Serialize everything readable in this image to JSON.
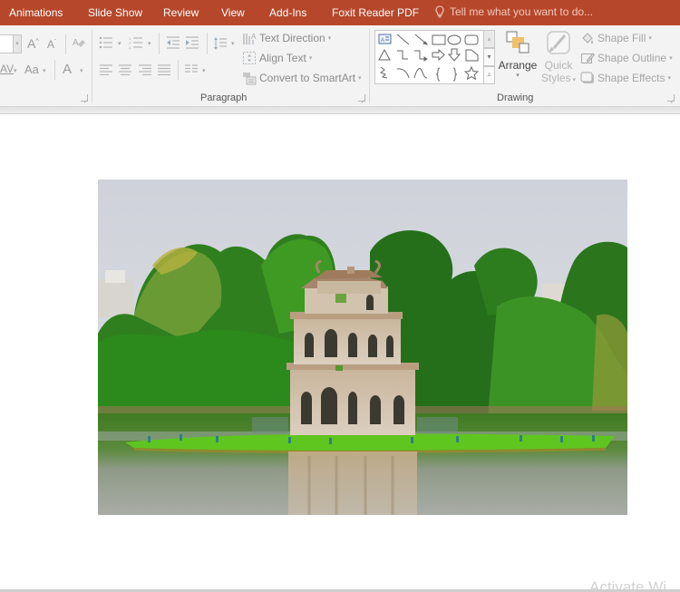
{
  "tabs": [
    {
      "label": "Animations"
    },
    {
      "label": "Slide Show"
    },
    {
      "label": "Review"
    },
    {
      "label": "View"
    },
    {
      "label": "Add-Ins"
    },
    {
      "label": "Foxit Reader PDF"
    }
  ],
  "tell_me": {
    "placeholder": "Tell me what you want to do...",
    "icon": "lightbulb-icon"
  },
  "ribbon": {
    "font_group": {
      "font_size_value": "",
      "increase_font_icon": "A",
      "decrease_font_icon": "A",
      "char_spacing_icon": "AV",
      "change_case_label": "Aa",
      "font_color_icon": "A"
    },
    "paragraph_group": {
      "label": "Paragraph",
      "text_direction": "Text Direction",
      "align_text": "Align Text",
      "convert_smartart": "Convert to SmartArt"
    },
    "drawing_group": {
      "label": "Drawing",
      "arrange": "Arrange",
      "quick_styles_line1": "Quick",
      "quick_styles_line2": "Styles",
      "shape_fill": "Shape Fill",
      "shape_outline": "Shape Outline",
      "shape_effects": "Shape Effects",
      "gallery_shapes": [
        "text-box",
        "line",
        "arrow-line",
        "rectangle",
        "oval",
        "rounded-rectangle",
        "triangle",
        "elbow-connector",
        "elbow-arrow-connector",
        "right-arrow",
        "down-arrow",
        "flowchart-shape",
        "freeform",
        "arc",
        "curve",
        "left-brace",
        "right-brace",
        "star"
      ]
    }
  },
  "slide": {
    "image_description": "Turtle Tower on Hoan Kiem Lake, Hanoi, surrounded by green trees and reflected in the water"
  },
  "watermark": "Activate Wi",
  "colors": {
    "accent": "#b7472a",
    "ribbon_bg": "#f3f3f3",
    "tab_text": "#ffffff"
  }
}
